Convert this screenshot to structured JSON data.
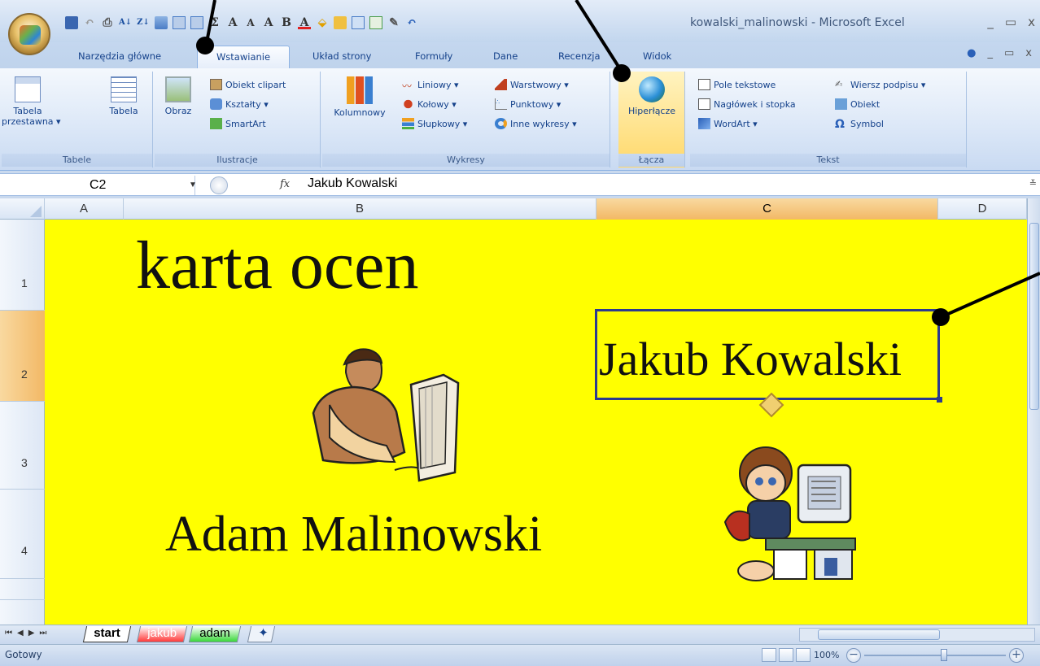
{
  "window": {
    "title": "kowalski_malinowski - Microsoft Excel",
    "minimize": "_",
    "restore": "▭",
    "close": "x"
  },
  "quick_access": {
    "items": [
      "save-icon",
      "undo-icon",
      "print-preview-icon",
      "sort-asc-icon",
      "sort-desc-icon",
      "table-icon",
      "borders-icon",
      "sum-icon",
      "font-size-up-icon",
      "font-size-down-icon",
      "bold-icon",
      "font-color-icon",
      "fill-color-icon",
      "folder-icon",
      "grid-icon",
      "chart-icon",
      "draw-icon",
      "undo2-icon"
    ],
    "sum": "Σ",
    "a1": "A",
    "a2": "A",
    "a3": "A",
    "bold": "B",
    "font_color": "A"
  },
  "tabs": [
    {
      "label": "Narzędzia główne"
    },
    {
      "label": "Wstawianie"
    },
    {
      "label": "Układ strony"
    },
    {
      "label": "Formuły"
    },
    {
      "label": "Dane"
    },
    {
      "label": "Recenzja"
    },
    {
      "label": "Widok"
    }
  ],
  "ribbon": {
    "tables": {
      "label": "Tabele",
      "pivot": "Tabela\nprzestawna ▾",
      "table": "Tabela"
    },
    "illustrations": {
      "label": "Ilustracje",
      "picture": "Obraz",
      "clipart": "Obiekt clipart",
      "shapes": "Kształty ▾",
      "smartart": "SmartArt"
    },
    "charts": {
      "label": "Wykresy",
      "column": "Kolumnowy",
      "line": "Liniowy ▾",
      "pie": "Kołowy ▾",
      "bar": "Słupkowy ▾",
      "area": "Warstwowy ▾",
      "scatter": "Punktowy ▾",
      "other": "Inne wykresy ▾"
    },
    "links": {
      "label": "Łącza",
      "hyperlink": "Hiperłącze"
    },
    "text": {
      "label": "Tekst",
      "textbox": "Pole tekstowe",
      "header_footer": "Nagłówek i stopka",
      "wordart": "WordArt ▾",
      "signature": "Wiersz podpisu ▾",
      "object": "Obiekt",
      "symbol": "Symbol"
    }
  },
  "formula_bar": {
    "name_box": "C2",
    "fx": "fx",
    "value": "Jakub Kowalski"
  },
  "columns": [
    "A",
    "B",
    "C",
    "D"
  ],
  "rows": [
    "1",
    "2",
    "3",
    "4"
  ],
  "sheet": {
    "title": "karta ocen",
    "student1": "Adam Malinowski",
    "student2": "Jakub Kowalski"
  },
  "sheet_tabs": [
    {
      "label": "start",
      "color": "#ffff00"
    },
    {
      "label": "jakub",
      "color": "#ff3333"
    },
    {
      "label": "adam",
      "color": "#33dd33"
    }
  ],
  "status": {
    "ready": "Gotowy",
    "zoom": "100%"
  }
}
